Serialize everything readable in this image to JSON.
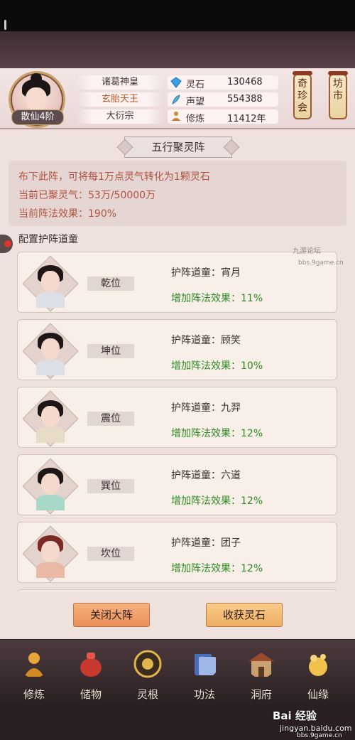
{
  "header": {
    "rank": "散仙4阶",
    "tags": [
      "诸葛神皇",
      "玄胎天王",
      "大衍宗"
    ],
    "stats": [
      {
        "icon": "gem-icon",
        "label": "灵石",
        "value": "130468"
      },
      {
        "icon": "feather-icon",
        "label": "声望",
        "value": "554388"
      },
      {
        "icon": "meditation-icon",
        "label": "修炼",
        "value": "11412年"
      }
    ],
    "lanterns": [
      "奇珍会",
      "坊市"
    ]
  },
  "panel": {
    "title": "五行聚灵阵",
    "info_lines": [
      "布下此阵，可将每1万点灵气转化为1颗灵石",
      "当前已聚灵气：53万/50000万",
      "当前阵法效果：190%"
    ],
    "section_title": "配置护阵道童",
    "cards": [
      {
        "position": "乾位",
        "guard": "护阵道童：宵月",
        "boost": "增加阵法效果：11%"
      },
      {
        "position": "坤位",
        "guard": "护阵道童：顾笑",
        "boost": "增加阵法效果：10%"
      },
      {
        "position": "震位",
        "guard": "护阵道童：九羿",
        "boost": "增加阵法效果：12%"
      },
      {
        "position": "巽位",
        "guard": "护阵道童：六道",
        "boost": "增加阵法效果：12%"
      },
      {
        "position": "坎位",
        "guard": "护阵道童：团子",
        "boost": "增加阵法效果：12%"
      }
    ],
    "buttons": {
      "close": "关闭大阵",
      "collect": "收获灵石"
    }
  },
  "nav": [
    {
      "label": "修炼",
      "icon": "cultivation-icon"
    },
    {
      "label": "储物",
      "icon": "storage-bag-icon"
    },
    {
      "label": "灵根",
      "icon": "spirit-root-icon"
    },
    {
      "label": "功法",
      "icon": "technique-book-icon"
    },
    {
      "label": "洞府",
      "icon": "cave-mansion-icon"
    },
    {
      "label": "仙缘",
      "icon": "fortune-icon"
    }
  ],
  "watermark": {
    "baidu": "Bai 经验",
    "baidu_url": "jingyan.baidu.com",
    "site_url": "bbs.9game.cn",
    "site_name": "九游论坛"
  },
  "colors": {
    "info_text": "#b0523e",
    "boost_text": "#2e8b23",
    "close_button": "#ec8e58",
    "collect_button": "#efae63"
  }
}
